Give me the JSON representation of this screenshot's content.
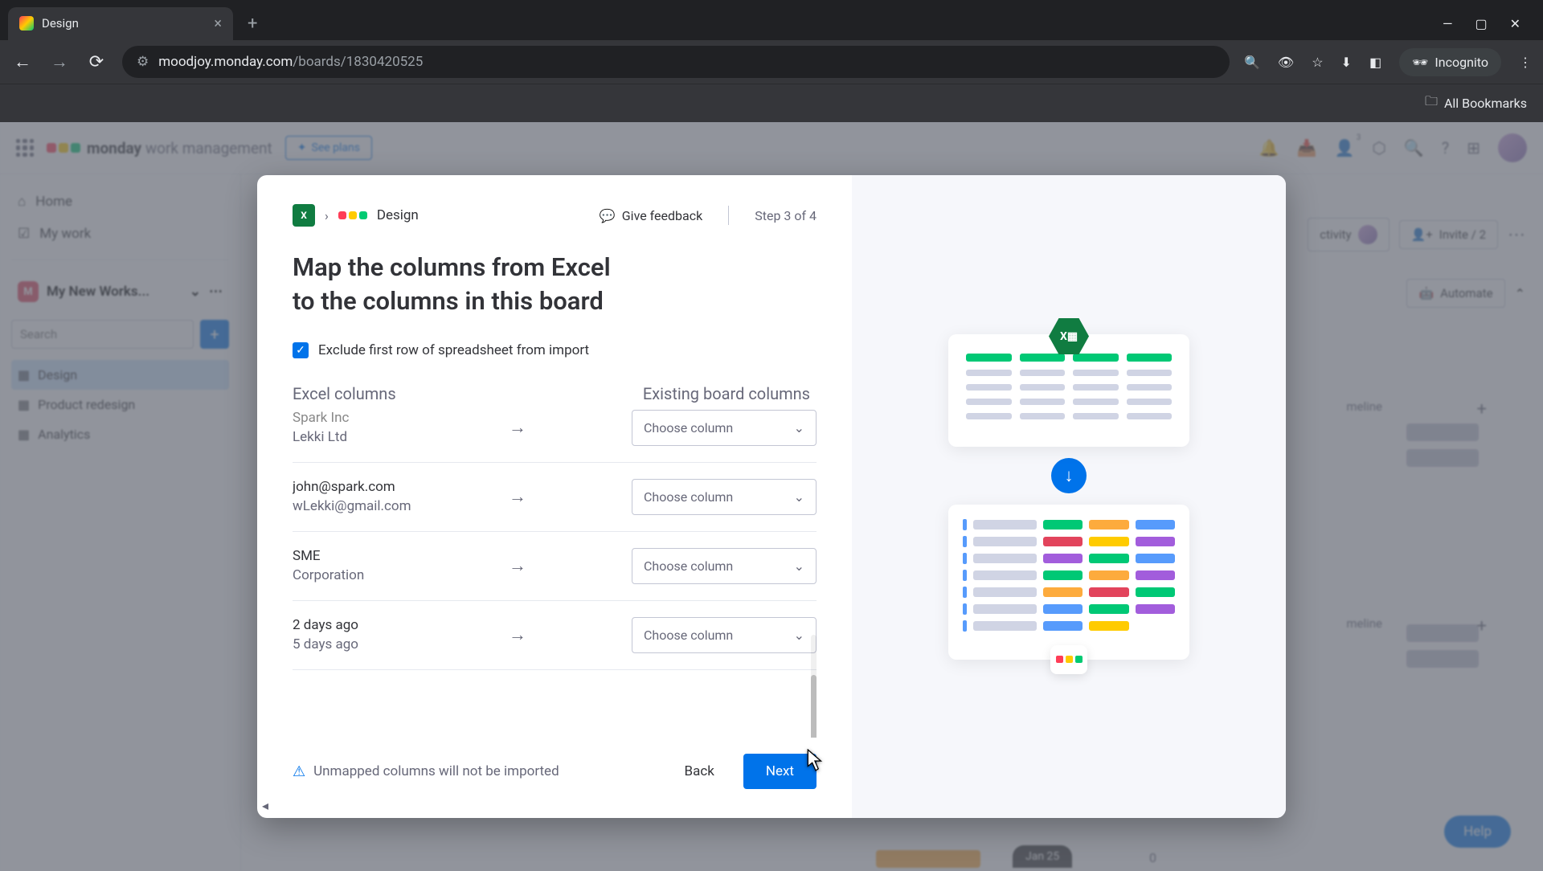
{
  "browser": {
    "tab_title": "Design",
    "url_prefix": "moodjoy.monday.com",
    "url_path": "/boards/1830420525",
    "incognito": "Incognito",
    "all_bookmarks": "All Bookmarks"
  },
  "app": {
    "brand_bold": "monday",
    "brand_sub": "work management",
    "see_plans": "See plans",
    "notification_badge": "3",
    "sidebar": {
      "home": "Home",
      "my_work": "My work",
      "workspace": "My New Works...",
      "search_placeholder": "Search",
      "boards": [
        "Design",
        "Product redesign",
        "Analytics"
      ]
    },
    "toolbar": {
      "activity": "ctivity",
      "invite": "Invite / 2",
      "automate": "Automate",
      "timeline": "meline",
      "help": "Help",
      "date": "Jan 25",
      "zero": "0"
    }
  },
  "modal": {
    "breadcrumb_board": "Design",
    "feedback": "Give feedback",
    "step": "Step 3 of 4",
    "title_line1": "Map the columns from Excel",
    "title_line2": "to the columns in this board",
    "exclude_label": "Exclude first row of spreadsheet from import",
    "excel_header": "Excel columns",
    "board_header": "Existing board columns",
    "choose_placeholder": "Choose column",
    "rows": [
      {
        "l1": "Spark Inc",
        "l2": "Lekki Ltd",
        "truncated": true
      },
      {
        "l1": "john@spark.com",
        "l2": "wLekki@gmail.com"
      },
      {
        "l1": "SME",
        "l2": "Corporation"
      },
      {
        "l1": "2 days ago",
        "l2": "5 days ago"
      }
    ],
    "warning": "Unmapped columns will not be imported",
    "back": "Back",
    "next": "Next"
  },
  "colors": {
    "monday": [
      "#ff3d57",
      "#ffcb00",
      "#00ca72"
    ],
    "board_palette": [
      [
        "#00c875",
        "#fdab3d",
        "#579bfc"
      ],
      [
        "#e2445c",
        "#ffcb00",
        "#a25ddc"
      ],
      [
        "#a25ddc",
        "#00c875",
        "#579bfc"
      ],
      [
        "#00c875",
        "#fdab3d",
        "#a25ddc"
      ],
      [
        "#fdab3d",
        "#e2445c",
        "#00c875"
      ],
      [
        "#579bfc",
        "#00c875",
        "#a25ddc"
      ],
      [
        "#579bfc",
        "#ffcb00",
        ""
      ]
    ]
  }
}
